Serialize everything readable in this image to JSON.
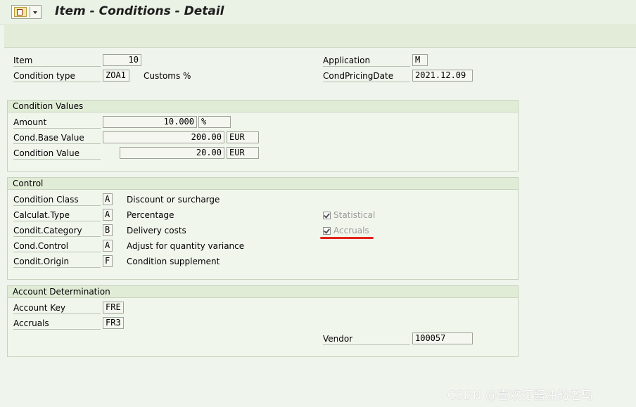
{
  "window": {
    "title": "Item - Conditions - Detail"
  },
  "header": {
    "item_label": "Item",
    "item_value": "10",
    "condition_type_label": "Condition type",
    "condition_type_value": "ZOA1",
    "condition_type_desc": "Customs %",
    "application_label": "Application",
    "application_value": "M",
    "cond_pricing_date_label": "CondPricingDate",
    "cond_pricing_date_value": "2021.12.09"
  },
  "condition_values": {
    "title": "Condition Values",
    "amount_label": "Amount",
    "amount_value": "10.000",
    "amount_unit": "%",
    "base_value_label": "Cond.Base Value",
    "base_value": "200.00",
    "base_currency": "EUR",
    "condition_value_label": "Condition Value",
    "condition_value": "20.00",
    "condition_currency": "EUR"
  },
  "control": {
    "title": "Control",
    "rows": [
      {
        "label": "Condition Class",
        "code": "A",
        "desc": "Discount or surcharge"
      },
      {
        "label": "Calculat.Type",
        "code": "A",
        "desc": "Percentage"
      },
      {
        "label": "Condit.Category",
        "code": "B",
        "desc": "Delivery costs"
      },
      {
        "label": "Cond.Control",
        "code": "A",
        "desc": "Adjust for quantity variance"
      },
      {
        "label": "Condit.Origin",
        "code": "F",
        "desc": "Condition supplement"
      }
    ],
    "statistical_label": "Statistical",
    "statistical_checked": true,
    "accruals_label": "Accruals",
    "accruals_checked": true,
    "highlight_color": "#e2231a"
  },
  "account_determination": {
    "title": "Account Determination",
    "account_key_label": "Account Key",
    "account_key_value": "FRE",
    "accruals_label": "Accruals",
    "accruals_value": "FR3",
    "vendor_label": "Vendor",
    "vendor_value": "100057"
  },
  "watermark": "CSDN @喜欢打酱油的老鸟"
}
